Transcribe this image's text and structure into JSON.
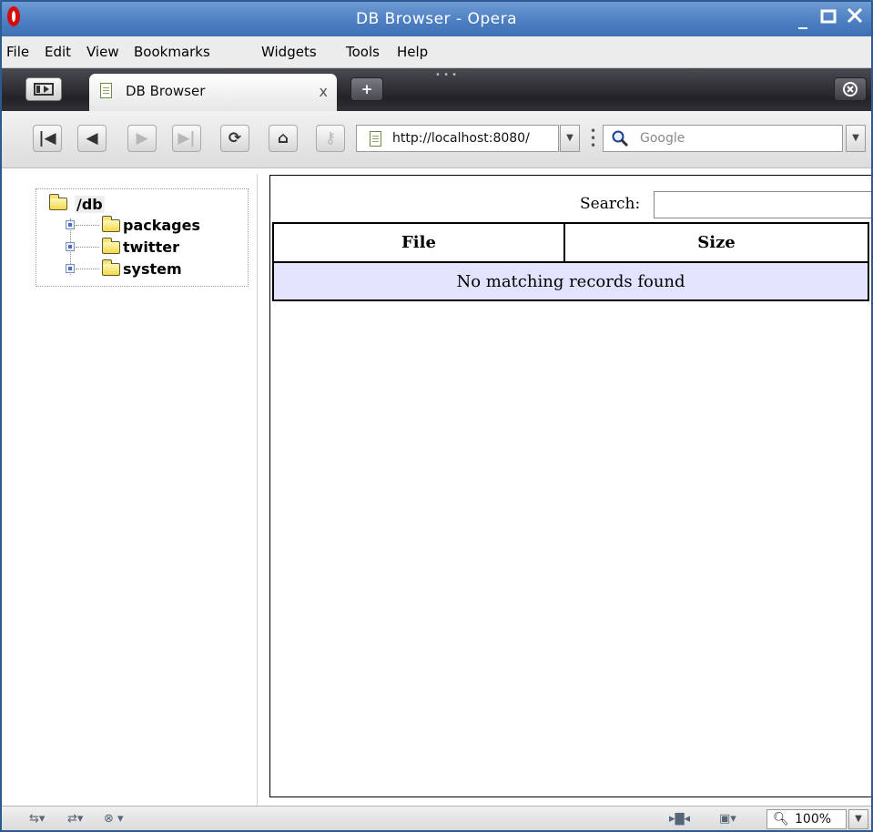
{
  "window": {
    "title": "DB Browser - Opera",
    "controls": [
      "minimize-icon",
      "maximize-icon",
      "close-icon"
    ]
  },
  "menu": {
    "items": [
      "File",
      "Edit",
      "View",
      "Bookmarks",
      "Widgets",
      "Tools",
      "Help"
    ]
  },
  "tabs": {
    "active_tab": {
      "label": "DB Browser",
      "close": "x"
    },
    "new_tab": "+"
  },
  "nav": {
    "address": "http://localhost:8080/",
    "search_engine": "Google"
  },
  "tree": {
    "root": "/db",
    "children": [
      "packages",
      "twitter",
      "system"
    ]
  },
  "table": {
    "search_label": "Search:",
    "search_value": "",
    "columns": [
      "File",
      "Size"
    ],
    "empty_message": "No matching records found"
  },
  "status": {
    "zoom": "100%"
  },
  "colors": {
    "titlebar": "#4b7dc0",
    "empty_row_bg": "#e2e4ff",
    "opera_red": "#d30c0c"
  }
}
